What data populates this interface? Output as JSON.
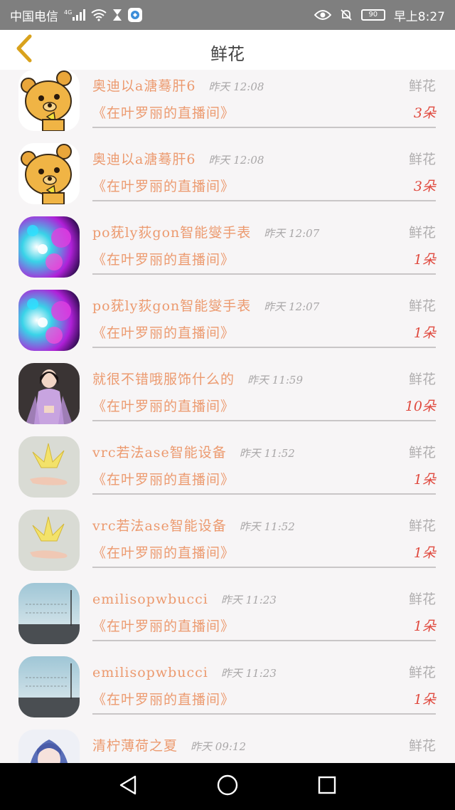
{
  "status_bar": {
    "carrier": "中国电信",
    "network": "4G",
    "time": "早上8:27",
    "battery": "90"
  },
  "header": {
    "title": "鲜花"
  },
  "list": {
    "items": [
      {
        "avatar": "bear-avatar",
        "sender": "奥迪以a溏蓦肝6",
        "time": "昨天 12:08",
        "gift_type": "鲜花",
        "room": "《在叶罗丽的直播间》",
        "count": "3朵"
      },
      {
        "avatar": "bear-avatar",
        "sender": "奥迪以a溏蓦肝6",
        "time": "昨天 12:08",
        "gift_type": "鲜花",
        "room": "《在叶罗丽的直播间》",
        "count": "3朵"
      },
      {
        "avatar": "sparkle-avatar",
        "sender": "po莸ly荻gon智能燮手表",
        "time": "昨天 12:07",
        "gift_type": "鲜花",
        "room": "《在叶罗丽的直播间》",
        "count": "1朵"
      },
      {
        "avatar": "sparkle-avatar",
        "sender": "po莸ly荻gon智能燮手表",
        "time": "昨天 12:07",
        "gift_type": "鲜花",
        "room": "《在叶罗丽的直播间》",
        "count": "1朵"
      },
      {
        "avatar": "girl-avatar",
        "sender": "就很不错哦服饰什么的",
        "time": "昨天 11:59",
        "gift_type": "鲜花",
        "room": "《在叶罗丽的直播间》",
        "count": "10朵"
      },
      {
        "avatar": "paper-crane-avatar",
        "sender": "vrc若法ase智能设备",
        "time": "昨天 11:52",
        "gift_type": "鲜花",
        "room": "《在叶罗丽的直播间》",
        "count": "1朵"
      },
      {
        "avatar": "paper-crane-avatar",
        "sender": "vrc若法ase智能设备",
        "time": "昨天 11:52",
        "gift_type": "鲜花",
        "room": "《在叶罗丽的直播间》",
        "count": "1朵"
      },
      {
        "avatar": "road-avatar",
        "sender": "emilisopwbucci",
        "time": "昨天 11:23",
        "gift_type": "鲜花",
        "room": "《在叶罗丽的直播间》",
        "count": "1朵"
      },
      {
        "avatar": "road-avatar",
        "sender": "emilisopwbucci",
        "time": "昨天 11:23",
        "gift_type": "鲜花",
        "room": "《在叶罗丽的直播间》",
        "count": "1朵"
      },
      {
        "avatar": "anime-girl-avatar",
        "sender": "清柠薄荷之夏",
        "time": "昨天 09:12",
        "gift_type": "鲜花",
        "room": "",
        "count": ""
      }
    ]
  },
  "colors": {
    "accent_text": "#ec9a6f",
    "count_text": "#e04a3f",
    "back_arrow": "#d9a21c",
    "status_bar_bg": "#7f7f7f"
  }
}
